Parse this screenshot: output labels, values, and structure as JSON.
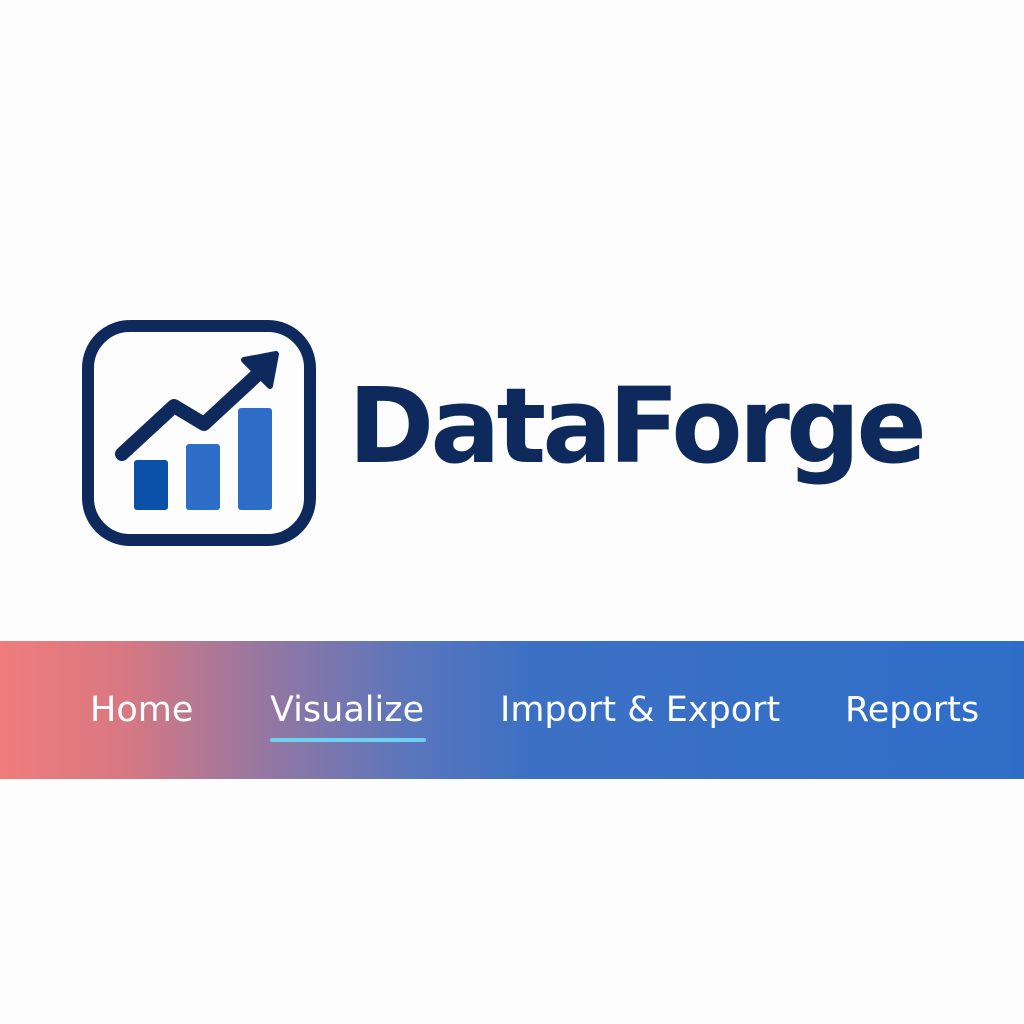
{
  "brand": {
    "name": "DataForge",
    "logo_icon": "bar-chart-trend-up-icon",
    "colors": {
      "primary": "#0e2a5c",
      "bar_dark": "#0a4fa8",
      "bar_light": "#2f6ec8"
    }
  },
  "nav": {
    "items": [
      {
        "label": "Home",
        "active": false
      },
      {
        "label": "Visualize",
        "active": true
      },
      {
        "label": "Import & Export",
        "active": false
      },
      {
        "label": "Reports",
        "active": false
      }
    ],
    "gradient_start": "#f07c7c",
    "gradient_end": "#2f6ec8",
    "active_indicator_color": "#6fd0ef"
  }
}
